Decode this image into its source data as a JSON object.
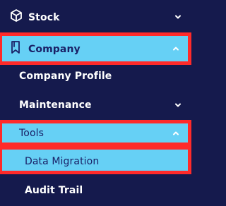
{
  "menu": {
    "items": [
      {
        "label": "Stock",
        "icon": "cube-icon",
        "chevron": "chevron-down-icon"
      },
      {
        "label": "Company",
        "icon": "bookmark-icon",
        "chevron": "chevron-up-icon"
      },
      {
        "label": "Company Profile"
      },
      {
        "label": "Maintenance",
        "chevron": "chevron-down-icon"
      },
      {
        "label": "Tools",
        "chevron": "chevron-up-icon"
      },
      {
        "label": "Data Migration"
      },
      {
        "label": "Audit Trail"
      }
    ]
  },
  "colors": {
    "background": "#151a4d",
    "highlight": "#66d0f5",
    "highlight_border": "#ff2a2a",
    "text": "#ffffff",
    "highlight_text": "#1a2167"
  }
}
